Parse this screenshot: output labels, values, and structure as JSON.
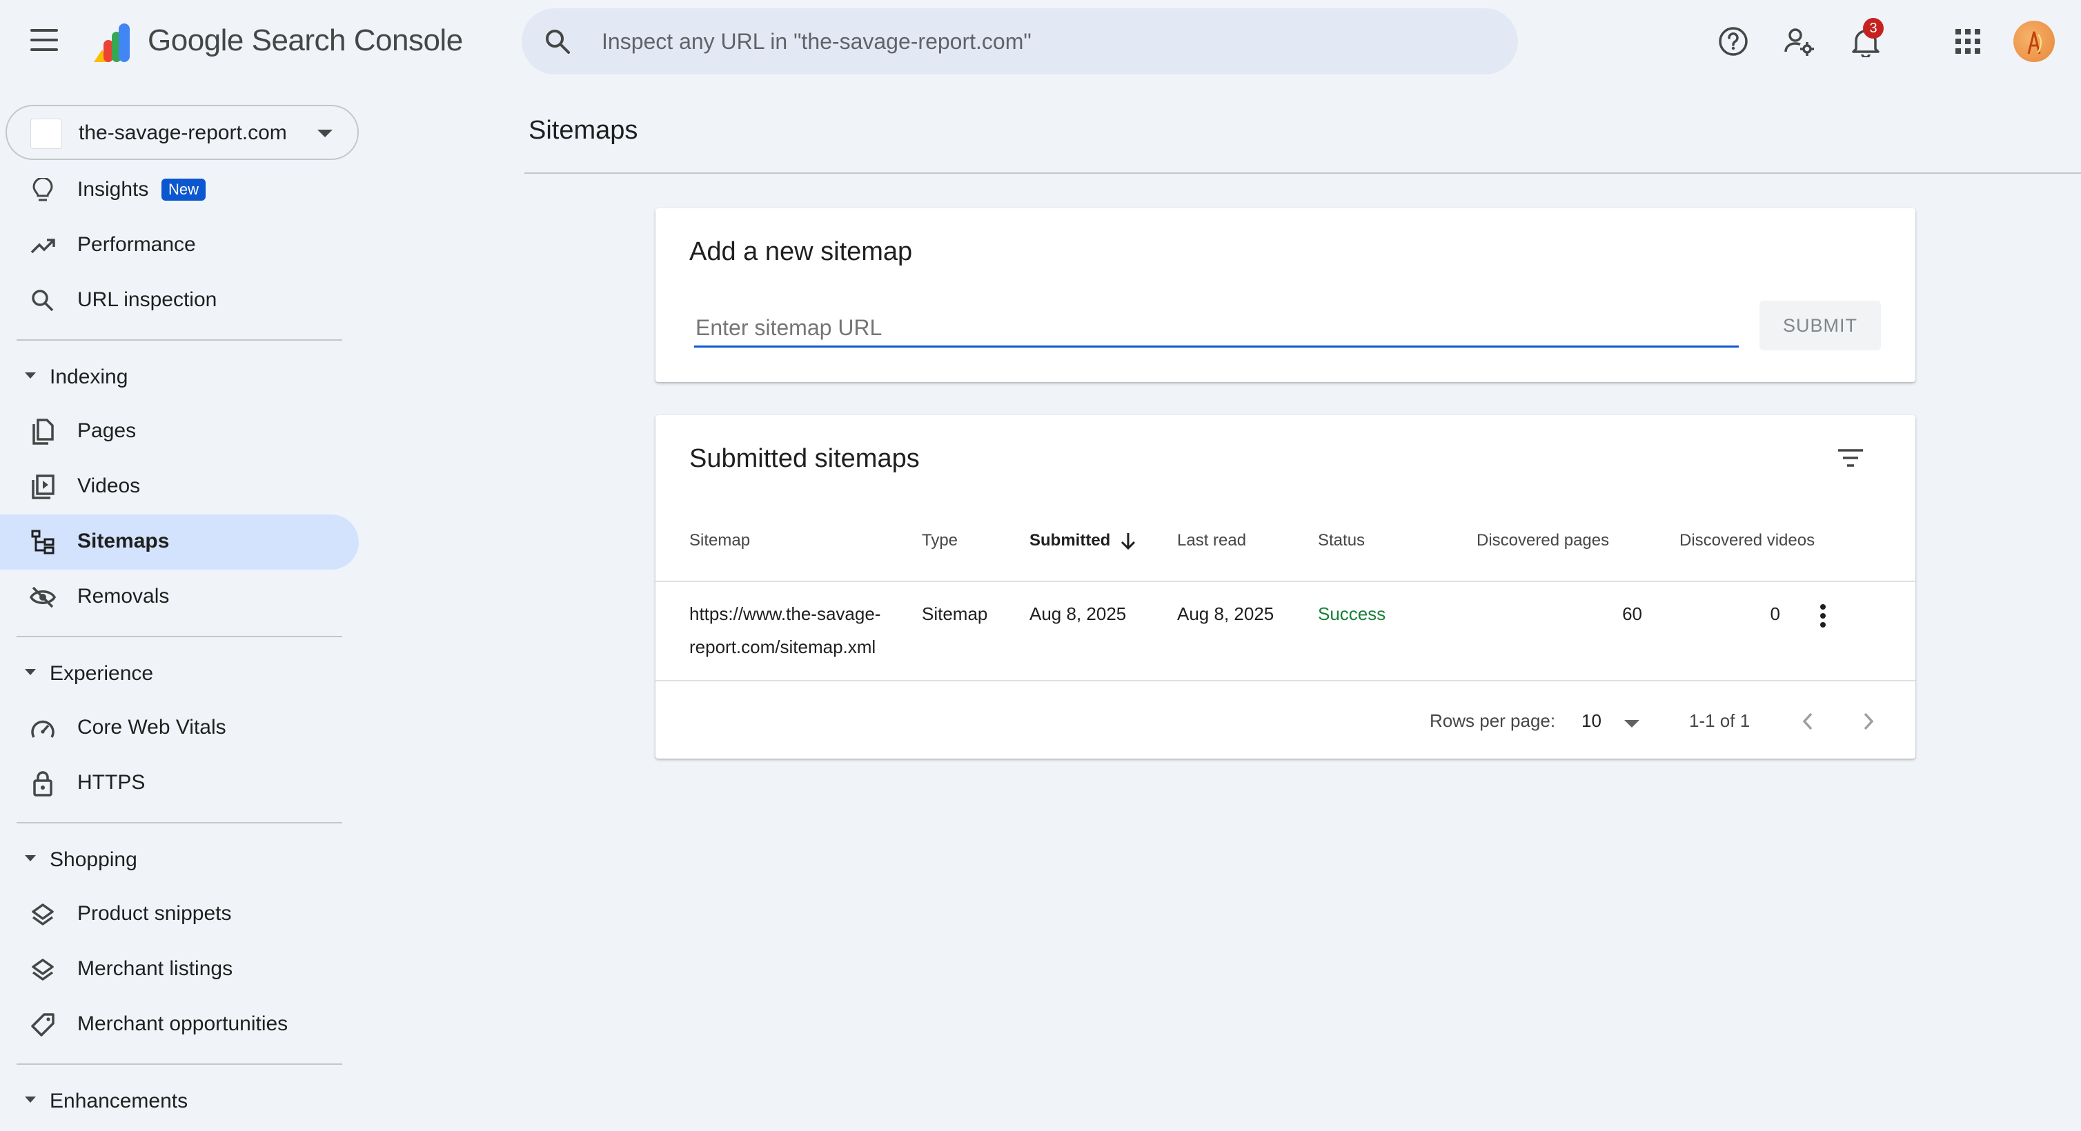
{
  "app": {
    "brand": "Google Search Console"
  },
  "search": {
    "placeholder": "Inspect any URL in \"the-savage-report.com\""
  },
  "header": {
    "notification_count": "3"
  },
  "property": {
    "name": "the-savage-report.com"
  },
  "sidebar": {
    "items": [
      {
        "label": "Insights",
        "badge": "New",
        "icon": "lightbulb-icon"
      },
      {
        "label": "Performance",
        "icon": "trending-up-icon"
      },
      {
        "label": "URL inspection",
        "icon": "search-icon"
      }
    ],
    "sections": [
      {
        "label": "Indexing",
        "items": [
          {
            "label": "Pages",
            "icon": "pages-icon"
          },
          {
            "label": "Videos",
            "icon": "video-library-icon"
          },
          {
            "label": "Sitemaps",
            "icon": "sitemap-icon",
            "active": true
          },
          {
            "label": "Removals",
            "icon": "visibility-off-icon"
          }
        ]
      },
      {
        "label": "Experience",
        "items": [
          {
            "label": "Core Web Vitals",
            "icon": "speed-gauge-icon"
          },
          {
            "label": "HTTPS",
            "icon": "lock-icon"
          }
        ]
      },
      {
        "label": "Shopping",
        "items": [
          {
            "label": "Product snippets",
            "icon": "layers-icon"
          },
          {
            "label": "Merchant listings",
            "icon": "layers-icon"
          },
          {
            "label": "Merchant opportunities",
            "icon": "tag-icon"
          }
        ]
      },
      {
        "label": "Enhancements",
        "items": []
      }
    ]
  },
  "main": {
    "page_title": "Sitemaps",
    "add_card": {
      "title": "Add a new sitemap",
      "input_placeholder": "Enter sitemap URL",
      "submit_label": "SUBMIT"
    },
    "submitted_card": {
      "title": "Submitted sitemaps",
      "columns": [
        "Sitemap",
        "Type",
        "Submitted",
        "Last read",
        "Status",
        "Discovered pages",
        "Discovered videos"
      ],
      "sorted_column": "Submitted",
      "rows": [
        {
          "sitemap_line1": "https://www.the-savage-",
          "sitemap_line2": "report.com/sitemap.xml",
          "type": "Sitemap",
          "submitted": "Aug 8, 2025",
          "last_read": "Aug 8, 2025",
          "status": "Success",
          "discovered_pages": "60",
          "discovered_videos": "0"
        }
      ],
      "footer": {
        "rows_per_page_label": "Rows per page:",
        "rows_per_page_value": "10",
        "range": "1-1 of 1"
      }
    }
  },
  "colors": {
    "background": "#f0f4f9",
    "active_nav": "#d3e3fd",
    "accent": "#0b57d0",
    "success": "#188038",
    "badge": "#c5221f"
  }
}
